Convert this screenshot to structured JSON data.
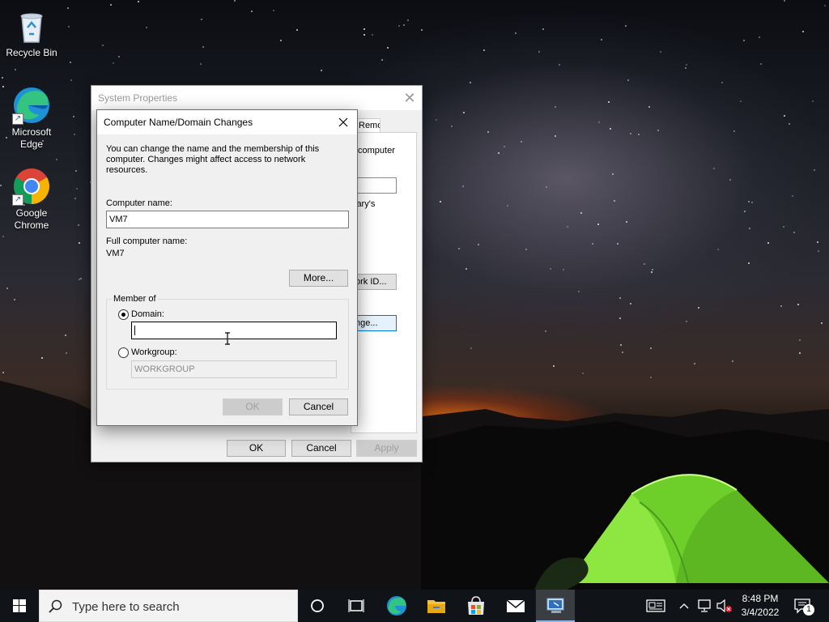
{
  "desktop": {
    "icons": [
      {
        "label": "Recycle Bin",
        "icon": "recycle-bin-icon"
      },
      {
        "label": "Microsoft Edge",
        "icon": "edge-icon"
      },
      {
        "label": "Google Chrome",
        "icon": "chrome-icon"
      }
    ]
  },
  "system_properties": {
    "title": "System Properties",
    "tab_remote": "Remote",
    "frag_computer": "computer",
    "frag_rys": "lary's",
    "frag_network_id": "ork ID...",
    "frag_change": "nge...",
    "ok": "OK",
    "cancel": "Cancel",
    "apply": "Apply"
  },
  "dialog": {
    "title": "Computer Name/Domain Changes",
    "intro": "You can change the name and the membership of this computer. Changes might affect access to network resources.",
    "computer_name_label": "Computer name:",
    "computer_name_value": "VM7",
    "full_name_label": "Full computer name:",
    "full_name_value": "VM7",
    "more_button": "More...",
    "member_of_label": "Member of",
    "domain_label": "Domain:",
    "domain_value": "",
    "domain_selected": true,
    "workgroup_label": "Workgroup:",
    "workgroup_value": "WORKGROUP",
    "ok": "OK",
    "cancel": "Cancel"
  },
  "taskbar": {
    "search_placeholder": "Type here to search",
    "pinned": [
      "cortana-icon",
      "task-view-icon",
      "edge-icon",
      "file-explorer-icon",
      "store-icon",
      "mail-icon",
      "system-properties-icon"
    ],
    "time": "8:48 PM",
    "date": "3/4/2022",
    "notification_count": "1"
  },
  "colors": {
    "accent": "#0078d7",
    "tent_green": "#7ed321",
    "horizon_orange": "#ff7a1a"
  }
}
